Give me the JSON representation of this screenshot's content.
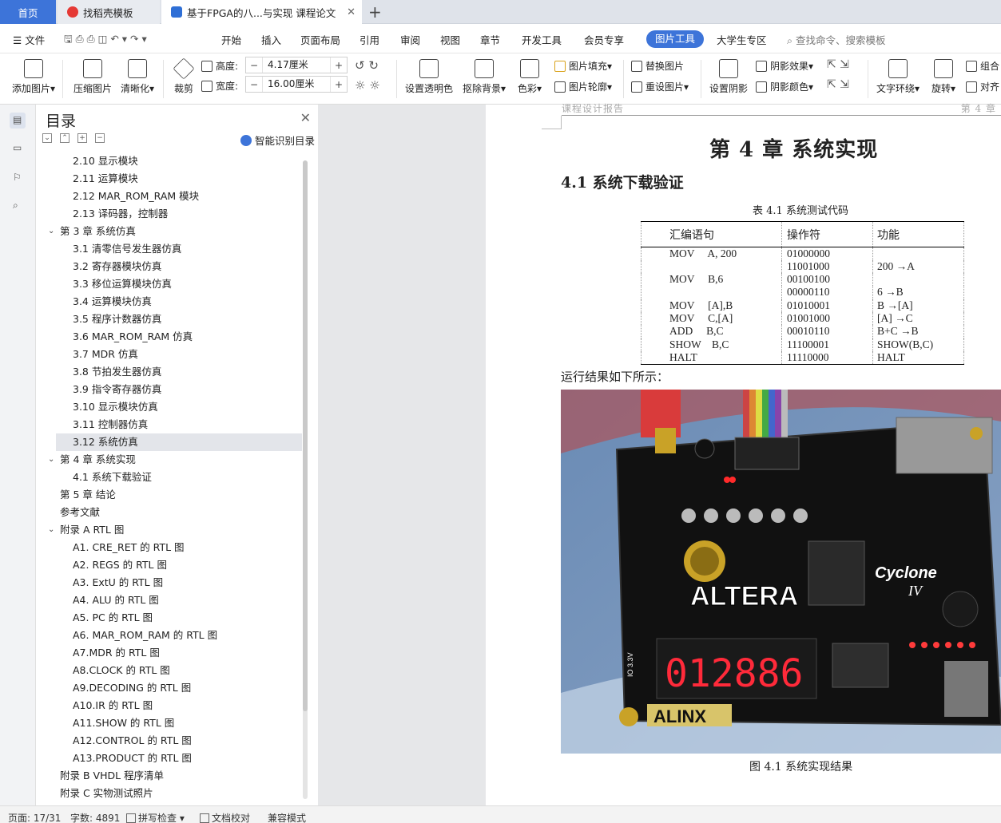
{
  "tabs": {
    "home": "首页",
    "template": "找稻壳模板",
    "document": "基于FPGA的八...与实现 课程论文"
  },
  "menu": {
    "file": "文件",
    "items": [
      "开始",
      "插入",
      "页面布局",
      "引用",
      "审阅",
      "视图",
      "章节",
      "开发工具",
      "会员专享"
    ],
    "active": "图片工具",
    "extra": "大学生专区",
    "search_placeholder": "查找命令、搜索模板"
  },
  "ribbon": {
    "add_picture": "添加图片",
    "compress": "压缩图片",
    "sharpen": "清晰化",
    "crop": "裁剪",
    "height_label": "高度:",
    "height_value": "4.17厘米",
    "width_label": "宽度:",
    "width_value": "16.00厘米",
    "transparent": "设置透明色",
    "remove_bg": "抠除背景",
    "color": "色彩",
    "fill": "图片填充",
    "outline": "图片轮廓",
    "replace": "替换图片",
    "reset": "重设图片",
    "shadow": "设置阴影",
    "shadow_effect": "阴影效果",
    "shadow_color": "阴影颜色",
    "wrap": "文字环绕",
    "rotate": "旋转",
    "group": "组合",
    "align": "对齐"
  },
  "toc": {
    "title": "目录",
    "smart": "智能识别目录",
    "items": [
      {
        "text": "2.10  显示模块",
        "level": 2
      },
      {
        "text": "2.11  运算模块",
        "level": 2
      },
      {
        "text": "2.12 MAR_ROM_RAM 模块",
        "level": 2
      },
      {
        "text": "2.13  译码器，控制器",
        "level": 2
      },
      {
        "text": "第 3 章  系统仿真",
        "level": 1,
        "caret": true
      },
      {
        "text": "3.1  清零信号发生器仿真",
        "level": 2
      },
      {
        "text": "3.2  寄存器模块仿真",
        "level": 2
      },
      {
        "text": "3.3  移位运算模块仿真",
        "level": 2
      },
      {
        "text": "3.4 运算模块仿真",
        "level": 2
      },
      {
        "text": "3.5 程序计数器仿真",
        "level": 2
      },
      {
        "text": "3.6 MAR_ROM_RAM 仿真",
        "level": 2
      },
      {
        "text": "3.7 MDR 仿真",
        "level": 2
      },
      {
        "text": "3.8  节拍发生器仿真",
        "level": 2
      },
      {
        "text": "3.9  指令寄存器仿真",
        "level": 2
      },
      {
        "text": "3.10  显示模块仿真",
        "level": 2
      },
      {
        "text": "3.11  控制器仿真",
        "level": 2
      },
      {
        "text": "3.12 系统仿真",
        "level": 2,
        "selected": true
      },
      {
        "text": "第 4 章  系统实现",
        "level": 1,
        "caret": true
      },
      {
        "text": "4.1  系统下载验证",
        "level": 2
      },
      {
        "text": "第 5 章  结论",
        "level": 1
      },
      {
        "text": "参考文献",
        "level": 1
      },
      {
        "text": "附录 A RTL 图",
        "level": 1,
        "caret": true
      },
      {
        "text": "A1. CRE_RET 的 RTL 图",
        "level": 2
      },
      {
        "text": "A2. REGS 的 RTL 图",
        "level": 2
      },
      {
        "text": "A3. ExtU 的 RTL 图",
        "level": 2
      },
      {
        "text": "A4. ALU 的 RTL 图",
        "level": 2
      },
      {
        "text": "A5. PC 的 RTL 图",
        "level": 2
      },
      {
        "text": "A6. MAR_ROM_RAM 的 RTL 图",
        "level": 2
      },
      {
        "text": "A7.MDR 的 RTL 图",
        "level": 2
      },
      {
        "text": "A8.CLOCK 的 RTL 图",
        "level": 2
      },
      {
        "text": "A9.DECODING 的 RTL 图",
        "level": 2
      },
      {
        "text": "A10.IR 的 RTL 图",
        "level": 2
      },
      {
        "text": "A11.SHOW 的 RTL 图",
        "level": 2
      },
      {
        "text": "A12.CONTROL 的 RTL 图",
        "level": 2
      },
      {
        "text": "A13.PRODUCT 的 RTL 图",
        "level": 2
      },
      {
        "text": "附录 B VHDL 程序清单",
        "level": 1
      },
      {
        "text": "附录 C  实物测试照片",
        "level": 1
      }
    ]
  },
  "doc": {
    "header_left": "课程设计报告",
    "header_right": "第 4 章",
    "chapter_title": "第 4 章  系统实现",
    "section_title": "4.1  系统下载验证",
    "table_caption": "表 4.1 系统测试代码",
    "table_headers": [
      "汇编语句",
      "操作符",
      "功能"
    ],
    "table_rows": [
      [
        "MOV     A, 200",
        "01000000",
        ""
      ],
      [
        "",
        "11001000",
        "200 →A"
      ],
      [
        "MOV     B,6",
        "00100100",
        ""
      ],
      [
        "",
        "00000110",
        "6 →B"
      ],
      [
        "MOV     [A],B",
        "01010001",
        "B →[A]"
      ],
      [
        "MOV     C,[A]",
        "01001000",
        "[A] →C"
      ],
      [
        "ADD     B,C",
        "00010110",
        "B+C →B"
      ],
      [
        "SHOW    B,C",
        "11100001",
        "SHOW(B,C)"
      ],
      [
        "HALT",
        "11110000",
        "HALT"
      ]
    ],
    "paragraph": "运行结果如下所示：",
    "figure_caption": "图 4.1  系统实现结果",
    "photo": {
      "brand": "ALTERA",
      "chip": "Cyclone",
      "chip_gen": "IV",
      "display": "012886",
      "board": "ALINX",
      "voltage": "IO 3.3V"
    }
  },
  "status": {
    "page": "页面: 17/31",
    "words": "字数: 4891",
    "spell": "拼写检查",
    "proof": "文档校对",
    "compat": "兼容模式"
  }
}
